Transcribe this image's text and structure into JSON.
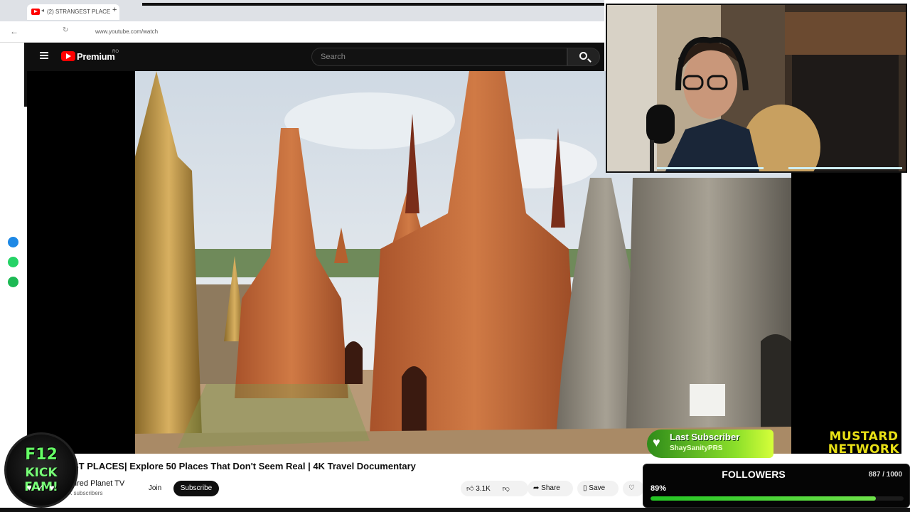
{
  "browser": {
    "tab_title": "(2) STRANGEST PLACE",
    "new_tab_symbol": "+",
    "address": "www.youtube.com/watch"
  },
  "youtube": {
    "logo_text": "Premium",
    "region": "RO",
    "search_placeholder": "Search"
  },
  "video": {
    "title": "ST PLACES| Explore 50 Places That Don't Seem Real | 4K Travel Documentary",
    "channel": "ured Planet TV",
    "subscribers": "K subscribers",
    "join_label": "Join",
    "subscribe_label": "Subscribe",
    "like_count": "3.1K",
    "share_label": "Share",
    "save_label": "Save"
  },
  "overlay": {
    "badge_top": "F12",
    "badge_bottom": "KICK FAM!",
    "badge_hearts": "♥ ✓ ♥",
    "last_subscriber_title": "Last Subscriber",
    "last_subscriber_name": "ShaySanityPRS",
    "network_line1": "MUSTARD",
    "network_line2": "NETWORK",
    "followers_title": "FOLLOWERS",
    "followers_count": "887 / 1000",
    "followers_percent": "89%",
    "followers_progress": 0.89
  },
  "colors": {
    "accent_red": "#ff0000",
    "progress_green": "#23c423",
    "subscriber_green": "#8bdf2a",
    "network_yellow": "#e8e016"
  }
}
